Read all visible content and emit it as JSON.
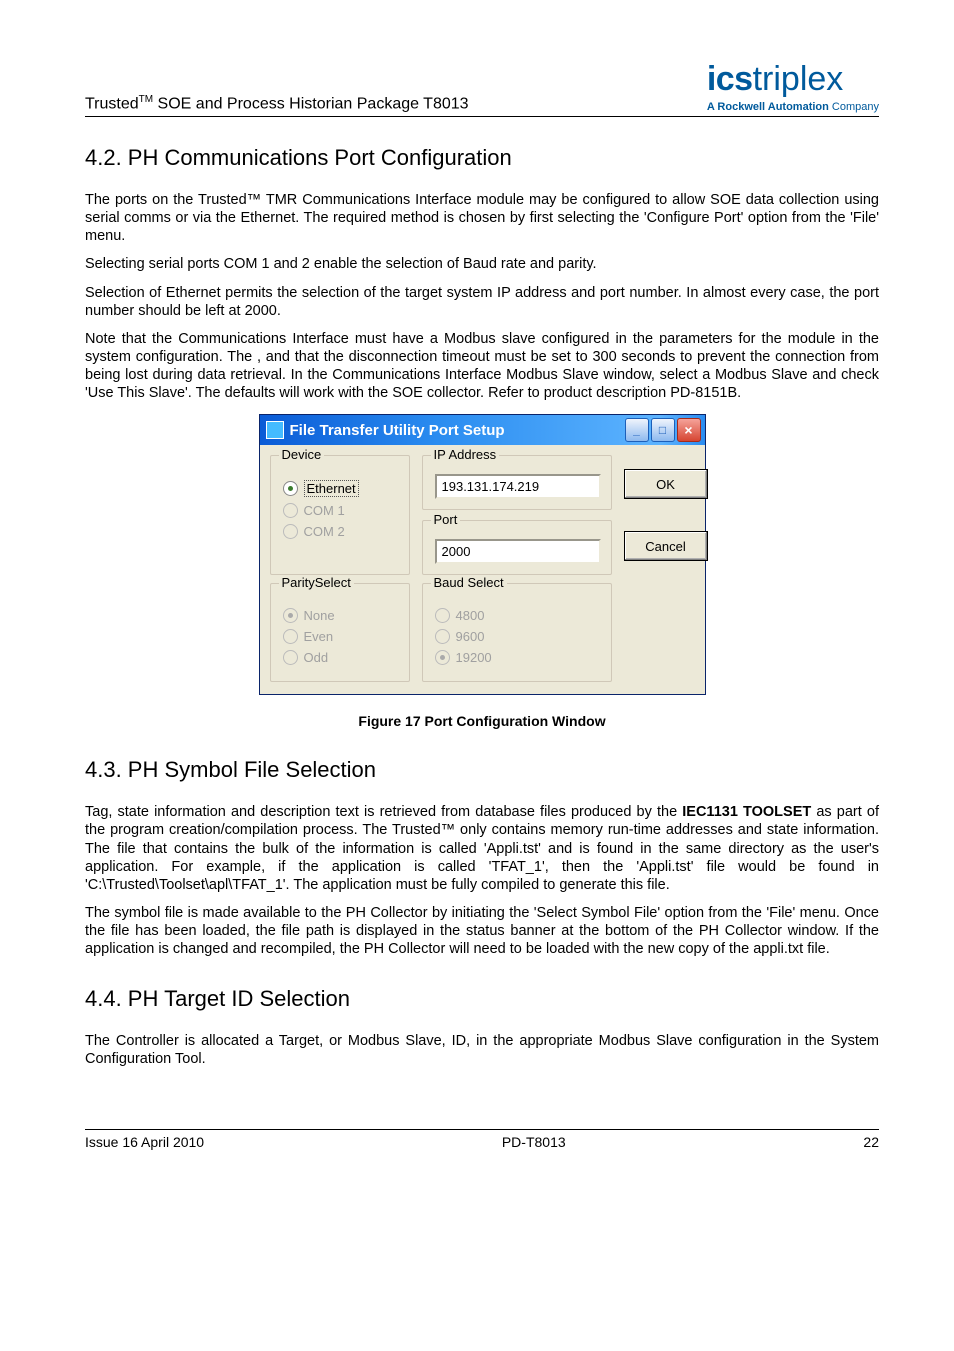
{
  "header": {
    "title": "Trusted™ SOE and Process Historian Package T8013",
    "logo_text1": "ics",
    "logo_text2": "triplex",
    "logo_tagline_bold": "A Rockwell Automation",
    "logo_tagline_normal": " Company"
  },
  "section42": {
    "heading": "4.2. PH Communications Port Configuration",
    "p1": "The ports on the Trusted™ TMR Communications Interface module may be configured to allow SOE data collection using serial comms or via the Ethernet. The required method is chosen by first selecting the 'Configure Port' option from the 'File' menu.",
    "p2": "Selecting serial ports COM 1 and 2 enable the selection of Baud rate and parity.",
    "p3": "Selection of Ethernet permits the selection of the target system IP address and port number. In almost every case, the port number should be left at 2000.",
    "p4": "Note that the Communications Interface must have a Modbus slave configured in the parameters for the module in the system configuration. The , and that the disconnection timeout must be set to 300 seconds to prevent the connection from being lost during data retrieval. In the Communications Interface Modbus Slave window, select a Modbus Slave and check 'Use This Slave'. The defaults will work with the SOE collector. Refer to product description PD-8151B."
  },
  "dialog": {
    "title": "File Transfer Utility Port Setup",
    "device_legend": "Device",
    "device_ethernet": "Ethernet",
    "device_com1": "COM 1",
    "device_com2": "COM 2",
    "ip_legend": "IP Address",
    "ip_value": "193.131.174.219",
    "port_legend": "Port",
    "port_value": "2000",
    "ok_label": "OK",
    "cancel_label": "Cancel",
    "parity_legend": "ParitySelect",
    "parity_none": "None",
    "parity_even": "Even",
    "parity_odd": "Odd",
    "baud_legend": "Baud Select",
    "baud_4800": "4800",
    "baud_9600": "9600",
    "baud_19200": "19200"
  },
  "fig17_caption": "Figure 17 Port Configuration Window",
  "section43": {
    "heading": "4.3. PH Symbol File Selection",
    "p1a": "Tag, state information and description text is retrieved from database files produced by the ",
    "p1b": "IEC1131 TOOLSET",
    "p1c": " as part of the program creation/compilation process. The Trusted™ only contains memory run-time addresses and state information. The file that contains the bulk of the information is called 'Appli.tst' and is found in the same directory as the user's application. For example, if the application is called 'TFAT_1', then the 'Appli.tst' file would be found in 'C:\\Trusted\\Toolset\\apl\\TFAT_1'. The application must be fully compiled to generate this file.",
    "p2": "The symbol file is made available to the PH Collector by initiating the 'Select Symbol File' option from the 'File' menu. Once the file has been loaded, the file path is displayed in the status banner at the bottom of the PH Collector window. If the application is changed and recompiled, the PH Collector will need to be loaded with the new copy of the appli.txt file."
  },
  "section44": {
    "heading": "4.4. PH Target ID Selection",
    "p1": "The Controller is allocated a Target, or Modbus Slave, ID, in the appropriate Modbus Slave configuration in the System Configuration Tool."
  },
  "footer": {
    "left": "Issue 16 April 2010",
    "center": "PD-T8013",
    "right": "22"
  }
}
